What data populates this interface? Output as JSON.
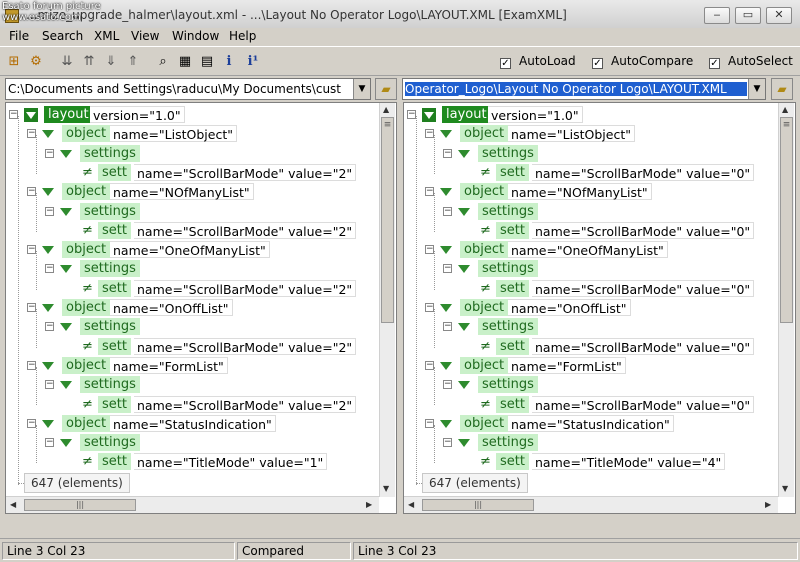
{
  "watermark": {
    "line1": "Esato forum picture",
    "line2": "www.esato.com"
  },
  "window": {
    "title": "...mize_upgrade_halmer\\layout.xml - ...\\Layout No Operator Logo\\LAYOUT.XML [ExamXML]",
    "minimize": "‒",
    "maximize": "▭",
    "close": "✕"
  },
  "menu": [
    "File",
    "Search",
    "XML",
    "View",
    "Window",
    "Help"
  ],
  "options": [
    {
      "label": "AutoLoad",
      "checked": true
    },
    {
      "label": "AutoCompare",
      "checked": true
    },
    {
      "label": "AutoSelect",
      "checked": true
    }
  ],
  "left": {
    "path": "C:\\Documents and Settings\\raducu\\My Documents\\cust",
    "root": {
      "tag": "layout",
      "attr": "version=\"1.0\""
    },
    "objects": [
      {
        "obj": "name=\"ListObject\"",
        "sett": "name=\"ScrollBarMode\" value=\"2\""
      },
      {
        "obj": "name=\"NOfManyList\"",
        "sett": "name=\"ScrollBarMode\" value=\"2\""
      },
      {
        "obj": "name=\"OneOfManyList\"",
        "sett": "name=\"ScrollBarMode\" value=\"2\""
      },
      {
        "obj": "name=\"OnOffList\"",
        "sett": "name=\"ScrollBarMode\" value=\"2\""
      },
      {
        "obj": "name=\"FormList\"",
        "sett": "name=\"ScrollBarMode\" value=\"2\""
      },
      {
        "obj": "name=\"StatusIndication\"",
        "sett": "name=\"TitleMode\" value=\"1\""
      }
    ],
    "count": "647 (elements)"
  },
  "right": {
    "path": "Operator_Logo\\Layout No Operator Logo\\LAYOUT.XML",
    "root": {
      "tag": "layout",
      "attr": "version=\"1.0\""
    },
    "objects": [
      {
        "obj": "name=\"ListObject\"",
        "sett": "name=\"ScrollBarMode\" value=\"0\""
      },
      {
        "obj": "name=\"NOfManyList\"",
        "sett": "name=\"ScrollBarMode\" value=\"0\""
      },
      {
        "obj": "name=\"OneOfManyList\"",
        "sett": "name=\"ScrollBarMode\" value=\"0\""
      },
      {
        "obj": "name=\"OnOffList\"",
        "sett": "name=\"ScrollBarMode\" value=\"0\""
      },
      {
        "obj": "name=\"FormList\"",
        "sett": "name=\"ScrollBarMode\" value=\"0\""
      },
      {
        "obj": "name=\"StatusIndication\"",
        "sett": "name=\"TitleMode\" value=\"4\""
      }
    ],
    "count": "647 (elements)"
  },
  "labels": {
    "object": "object",
    "settings": "settings",
    "sett": "sett",
    "neq": "≠"
  },
  "status": {
    "left": "Line 3  Col 23",
    "middle": "Compared",
    "right": "Line 3  Col 23"
  },
  "colors": {
    "tag_dark": "#1f8a1f",
    "tag_light": "#c9f0c9",
    "selection": "#1f5fd0"
  }
}
